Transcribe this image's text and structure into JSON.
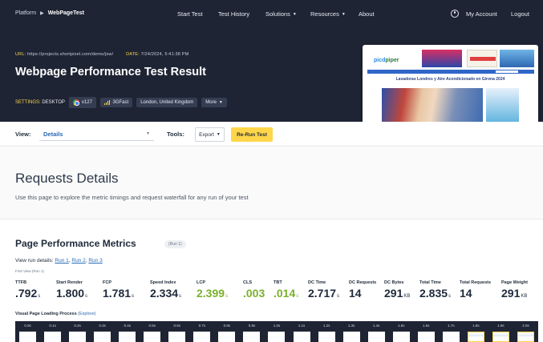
{
  "nav": {
    "crumb_root": "Platform",
    "crumb_current": "WebPageTest",
    "links": [
      "Start Test",
      "Test History",
      "Solutions",
      "Resources",
      "About"
    ],
    "account": "My Account",
    "logout": "Logout"
  },
  "test": {
    "url_label": "URL:",
    "url": "https://projects.shortpixel.com/demo/jsw/",
    "date_label": "DATE:",
    "date": "7/24/2024, 5:41:38 PM",
    "title": "Webpage Performance Test Result",
    "settings_label": "SETTINGS:",
    "device": "DESKTOP",
    "browser": "v127",
    "connection": "3GFast",
    "location": "London, United Kingdom",
    "more": "More"
  },
  "thumbnail": {
    "logo_a": "picd",
    "logo_b": "piper",
    "headline": "Lavadoras Londres y Aire Acondicionado en Girona 2024"
  },
  "toolbar": {
    "view_label": "View:",
    "view_value": "Details",
    "tools_label": "Tools:",
    "export": "Export",
    "rerun": "Re-Run Test"
  },
  "requests": {
    "title": "Requests Details",
    "subtitle": "Use this page to explore the metric timings and request waterfall for any run of your test"
  },
  "performance": {
    "title": "Page Performance Metrics",
    "run_badge": "(Run 1)",
    "run_details_label": "View run details:",
    "runs": [
      "Run 1",
      "Run 2",
      "Run 3"
    ],
    "first_view": "First View (Run 1)",
    "metrics": [
      {
        "label": "TTFB",
        "value": ".792",
        "unit": "s",
        "status": "neutral"
      },
      {
        "label": "Start Render",
        "value": "1.800",
        "unit": "s",
        "status": "neutral"
      },
      {
        "label": "FCP",
        "value": "1.781",
        "unit": "s",
        "status": "neutral"
      },
      {
        "label": "Speed Index",
        "value": "2.334",
        "unit": "s",
        "status": "neutral"
      },
      {
        "label": "LCP",
        "value": "2.399",
        "unit": "s",
        "status": "good"
      },
      {
        "label": "CLS",
        "value": ".003",
        "unit": "",
        "status": "good"
      },
      {
        "label": "TBT",
        "value": ".014",
        "unit": "s",
        "status": "good"
      },
      {
        "label": "DC Time",
        "value": "2.717",
        "unit": "s",
        "status": "neutral"
      },
      {
        "label": "DC Requests",
        "value": "14",
        "unit": "",
        "status": "neutral"
      },
      {
        "label": "DC Bytes",
        "value": "291",
        "unit": "KB",
        "status": "neutral"
      },
      {
        "label": "Total Time",
        "value": "2.835",
        "unit": "s",
        "status": "neutral"
      },
      {
        "label": "Total Requests",
        "value": "14",
        "unit": "",
        "status": "neutral"
      },
      {
        "label": "Page Weight",
        "value": "291",
        "unit": "KB",
        "status": "neutral"
      }
    ],
    "visual_label": "Visual Page Loading Process",
    "visual_link": "(Explore)",
    "frames": [
      "0.0s",
      "0.1s",
      "0.2s",
      "0.3s",
      "0.4s",
      "0.5s",
      "0.6s",
      "0.7s",
      "0.8s",
      "0.9s",
      "1.0s",
      "1.1s",
      "1.2s",
      "1.3s",
      "1.4s",
      "1.5s",
      "1.6s",
      "1.7s",
      "1.8s",
      "1.9s",
      "2.0s"
    ]
  },
  "colors": {
    "header_bg": "#1e2433",
    "accent_yellow": "#ffd64a",
    "link_blue": "#2a6ab5",
    "good_green": "#7bb02c"
  }
}
